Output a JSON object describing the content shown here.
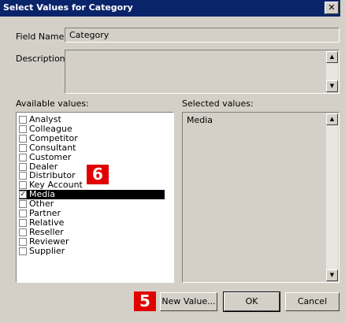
{
  "window": {
    "title": "Select Values for Category",
    "close_glyph": "✕"
  },
  "field_name": {
    "label": "Field Name:",
    "value": "Category"
  },
  "description": {
    "label": "Description:",
    "value": ""
  },
  "available": {
    "label": "Available values:",
    "items": [
      {
        "label": "Analyst",
        "checked": false,
        "selected": false
      },
      {
        "label": "Colleague",
        "checked": false,
        "selected": false
      },
      {
        "label": "Competitor",
        "checked": false,
        "selected": false
      },
      {
        "label": "Consultant",
        "checked": false,
        "selected": false
      },
      {
        "label": "Customer",
        "checked": false,
        "selected": false
      },
      {
        "label": "Dealer",
        "checked": false,
        "selected": false
      },
      {
        "label": "Distributor",
        "checked": false,
        "selected": false
      },
      {
        "label": "Key Account",
        "checked": false,
        "selected": false
      },
      {
        "label": "Media",
        "checked": true,
        "selected": true
      },
      {
        "label": "Other",
        "checked": false,
        "selected": false
      },
      {
        "label": "Partner",
        "checked": false,
        "selected": false
      },
      {
        "label": "Relative",
        "checked": false,
        "selected": false
      },
      {
        "label": "Reseller",
        "checked": false,
        "selected": false
      },
      {
        "label": "Reviewer",
        "checked": false,
        "selected": false
      },
      {
        "label": "Supplier",
        "checked": false,
        "selected": false
      }
    ]
  },
  "selected": {
    "label": "Selected values:",
    "items": [
      "Media"
    ]
  },
  "buttons": {
    "new_value": "New Value...",
    "ok": "OK",
    "cancel": "Cancel"
  },
  "callouts": {
    "list": "6",
    "new_value": "5"
  },
  "colors": {
    "titlebar": "#0a246a",
    "dialog_bg": "#d4d0c8",
    "callout": "#e00000"
  }
}
